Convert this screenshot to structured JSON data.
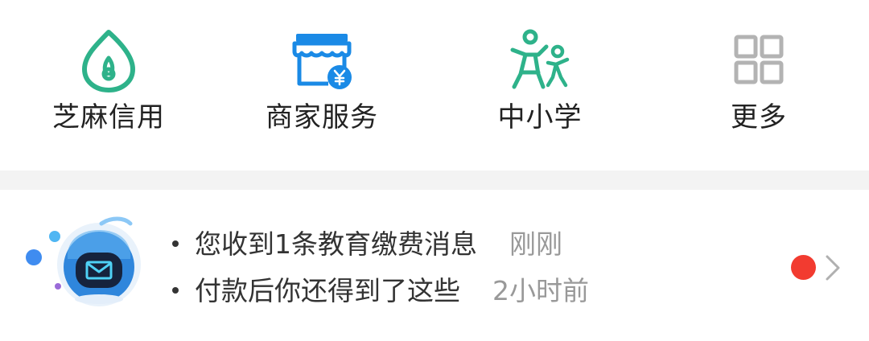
{
  "grid": {
    "items": [
      {
        "label": "芝麻信用",
        "icon": "sesame-credit-icon",
        "color": "#2eb28a"
      },
      {
        "label": "商家服务",
        "icon": "merchant-store-icon",
        "color": "#1a8ae6"
      },
      {
        "label": "中小学",
        "icon": "school-kids-icon",
        "color": "#2eb28a"
      },
      {
        "label": "更多",
        "icon": "more-grid-icon",
        "color": "#b3b3b3"
      }
    ]
  },
  "message": {
    "avatar": "robot-mail-icon",
    "lines": [
      {
        "text": "您收到1条教育缴费消息",
        "time": "刚刚"
      },
      {
        "text": "付款后你还得到了这些",
        "time": "2小时前"
      }
    ],
    "unread_color": "#f23b30"
  },
  "colors": {
    "divider": "#f3f3f3",
    "primary_text": "#333333",
    "secondary_text": "#999999"
  }
}
